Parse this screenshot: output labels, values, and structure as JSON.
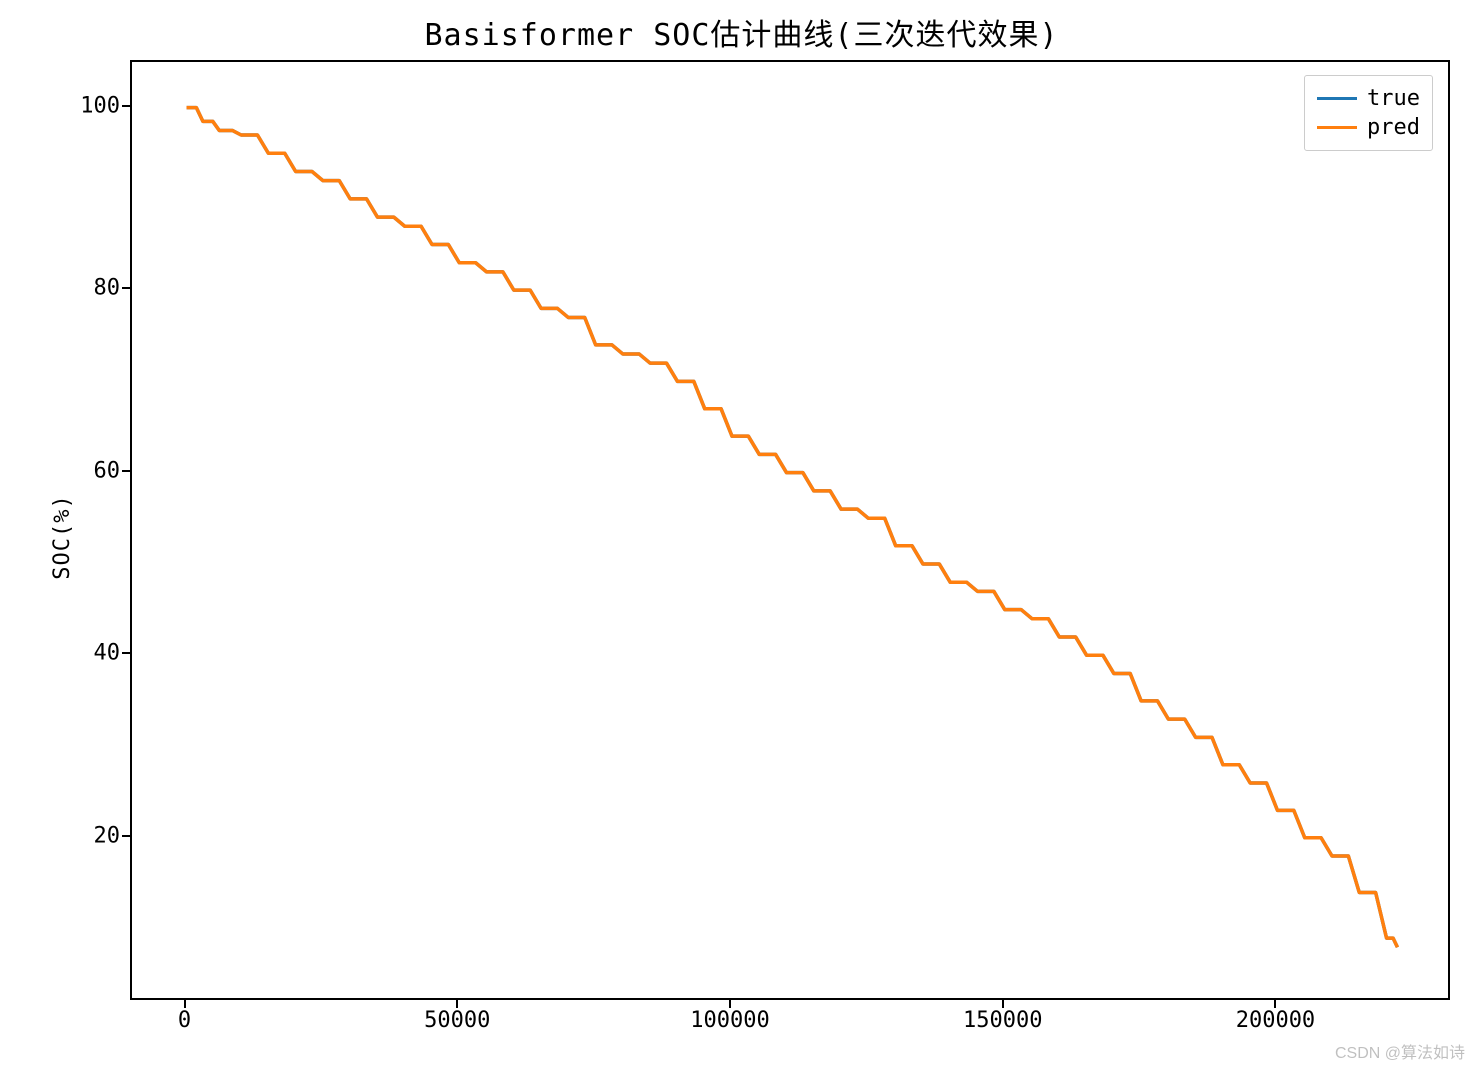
{
  "chart_data": {
    "type": "line",
    "title": "Basisformer SOC估计曲线(三次迭代效果)",
    "xlabel": "",
    "ylabel": "SOC(%)",
    "xlim": [
      -10000,
      232000
    ],
    "ylim": [
      2,
      105
    ],
    "xticks": [
      0,
      50000,
      100000,
      150000,
      200000
    ],
    "yticks": [
      20,
      40,
      60,
      80,
      100
    ],
    "series": [
      {
        "name": "true",
        "color": "#1f77b4",
        "x": [
          0,
          3000,
          6000,
          10000,
          15000,
          20000,
          25000,
          30000,
          35000,
          40000,
          45000,
          50000,
          55000,
          60000,
          65000,
          70000,
          75000,
          80000,
          85000,
          90000,
          95000,
          100000,
          105000,
          110000,
          115000,
          120000,
          125000,
          130000,
          135000,
          140000,
          145000,
          150000,
          155000,
          160000,
          165000,
          170000,
          175000,
          180000,
          185000,
          190000,
          195000,
          200000,
          205000,
          210000,
          215000,
          220000,
          222000
        ],
        "y": [
          100,
          98.5,
          97.5,
          97,
          95,
          93,
          92,
          90,
          88,
          87,
          85,
          83,
          82,
          80,
          78,
          77,
          74,
          73,
          72,
          70,
          67,
          64,
          62,
          60,
          58,
          56,
          55,
          52,
          50,
          48,
          47,
          45,
          44,
          42,
          40,
          38,
          35,
          33,
          31,
          28,
          26,
          23,
          20,
          18,
          14,
          9,
          8
        ]
      },
      {
        "name": "pred",
        "color": "#ff7f0e",
        "x": [
          0,
          3000,
          6000,
          10000,
          15000,
          20000,
          25000,
          30000,
          35000,
          40000,
          45000,
          50000,
          55000,
          60000,
          65000,
          70000,
          75000,
          80000,
          85000,
          90000,
          95000,
          100000,
          105000,
          110000,
          115000,
          120000,
          125000,
          130000,
          135000,
          140000,
          145000,
          150000,
          155000,
          160000,
          165000,
          170000,
          175000,
          180000,
          185000,
          190000,
          195000,
          200000,
          205000,
          210000,
          215000,
          220000,
          222000
        ],
        "y": [
          100,
          98.5,
          97.5,
          97,
          95,
          93,
          92,
          90,
          88,
          87,
          85,
          83,
          82,
          80,
          78,
          77,
          74,
          73,
          72,
          70,
          67,
          64,
          62,
          60,
          58,
          56,
          55,
          52,
          50,
          48,
          47,
          45,
          44,
          42,
          40,
          38,
          35,
          33,
          31,
          28,
          26,
          23,
          20,
          18,
          14,
          9,
          8
        ]
      }
    ]
  },
  "watermark": "CSDN @算法如诗"
}
